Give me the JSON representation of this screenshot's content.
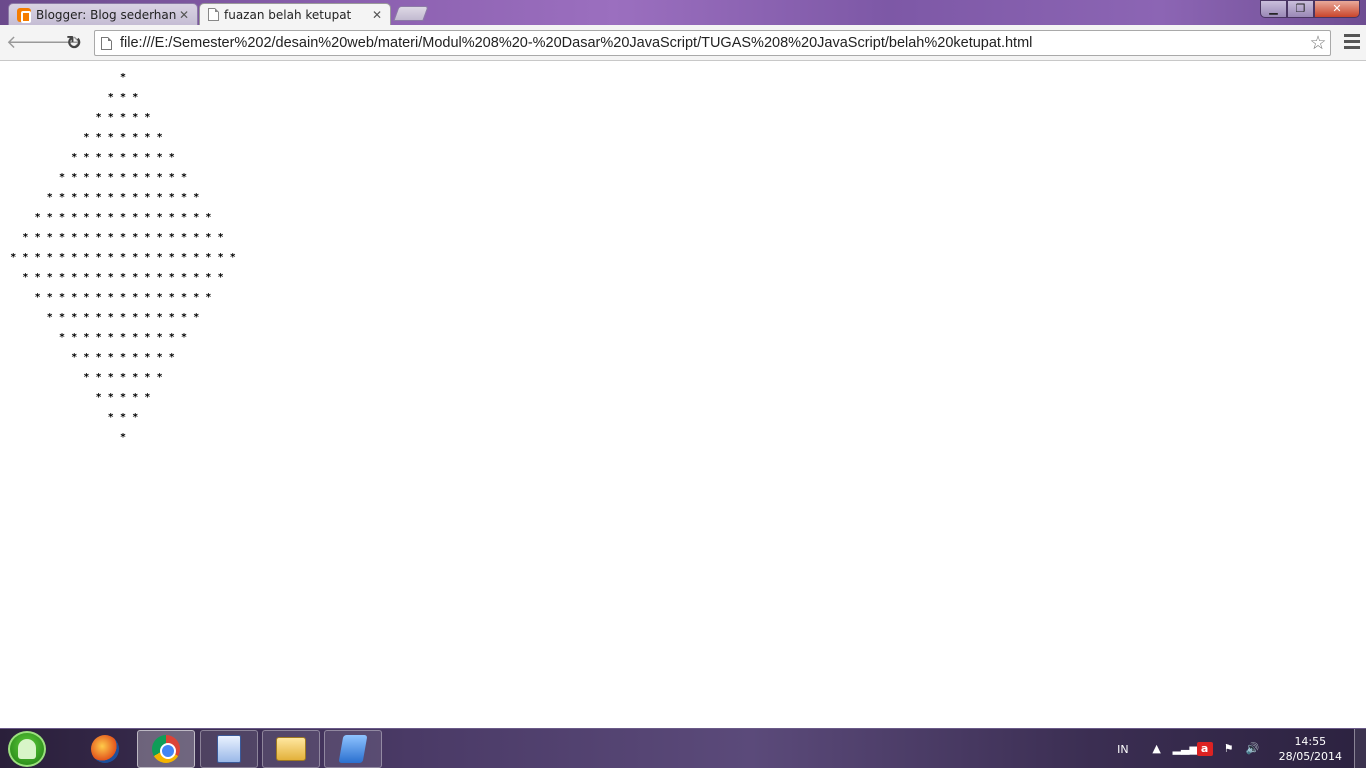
{
  "tabs": [
    {
      "title": "Blogger: Blog sederhana F",
      "icon": "blogger-icon",
      "active": false
    },
    {
      "title": "fuazan belah ketupat",
      "icon": "page-icon",
      "active": true
    }
  ],
  "toolbar": {
    "url": "file:///E:/Semester%202/desain%20web/materi/Modul%208%20-%20Dasar%20JavaScript/TUGAS%208%20JavaScript/belah%20ketupat.html"
  },
  "page": {
    "symbol": "*",
    "row_counts": [
      1,
      3,
      5,
      7,
      9,
      11,
      13,
      15,
      17,
      19,
      17,
      15,
      13,
      11,
      9,
      7,
      5,
      3,
      1
    ]
  },
  "taskbar": {
    "items": [
      "firefox-icon",
      "chrome-icon",
      "document-icon",
      "folder-icon",
      "app-icon"
    ],
    "language": "IN",
    "time": "14:55",
    "date": "28/05/2014"
  }
}
